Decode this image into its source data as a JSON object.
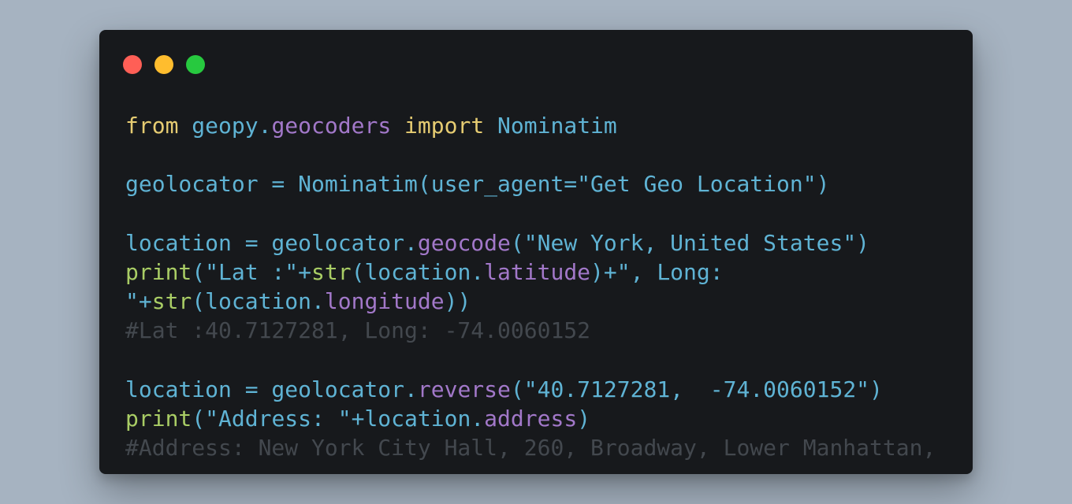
{
  "window": {
    "traffic_lights": {
      "close_color": "#ff5f56",
      "minimize_color": "#ffbd2e",
      "zoom_color": "#27c93f"
    }
  },
  "code": {
    "language": "python",
    "lines": [
      [
        {
          "t": "from",
          "c": "kw"
        },
        {
          "t": " geopy",
          "c": "plain"
        },
        {
          "t": ".",
          "c": "plain"
        },
        {
          "t": "geocoders",
          "c": "attr"
        },
        {
          "t": " ",
          "c": "plain"
        },
        {
          "t": "import",
          "c": "kw"
        },
        {
          "t": " Nominatim",
          "c": "plain"
        }
      ],
      [],
      [
        {
          "t": "geolocator = Nominatim(user_agent=\"Get Geo Location\")",
          "c": "plain"
        }
      ],
      [],
      [
        {
          "t": "location = geolocator.",
          "c": "plain"
        },
        {
          "t": "geocode",
          "c": "attr"
        },
        {
          "t": "(\"New York, United States\")",
          "c": "plain"
        }
      ],
      [
        {
          "t": "print",
          "c": "fn"
        },
        {
          "t": "(\"Lat :\"+",
          "c": "plain"
        },
        {
          "t": "str",
          "c": "fn"
        },
        {
          "t": "(location.",
          "c": "plain"
        },
        {
          "t": "latitude",
          "c": "attr"
        },
        {
          "t": ")+\", Long:",
          "c": "plain"
        }
      ],
      [
        {
          "t": "\"+",
          "c": "plain"
        },
        {
          "t": "str",
          "c": "fn"
        },
        {
          "t": "(location.",
          "c": "plain"
        },
        {
          "t": "longitude",
          "c": "attr"
        },
        {
          "t": "))",
          "c": "plain"
        }
      ],
      [
        {
          "t": "#Lat :40.7127281, Long: -74.0060152",
          "c": "com"
        }
      ],
      [],
      [
        {
          "t": "location = geolocator.",
          "c": "plain"
        },
        {
          "t": "reverse",
          "c": "attr"
        },
        {
          "t": "(\"40.7127281,  -74.0060152\")",
          "c": "plain"
        }
      ],
      [
        {
          "t": "print",
          "c": "fn"
        },
        {
          "t": "(\"Address: \"+location.",
          "c": "plain"
        },
        {
          "t": "address",
          "c": "attr"
        },
        {
          "t": ")",
          "c": "plain"
        }
      ],
      [
        {
          "t": "#Address: New York City Hall, 260, Broadway, Lower Manhattan,",
          "c": "com"
        }
      ]
    ]
  }
}
